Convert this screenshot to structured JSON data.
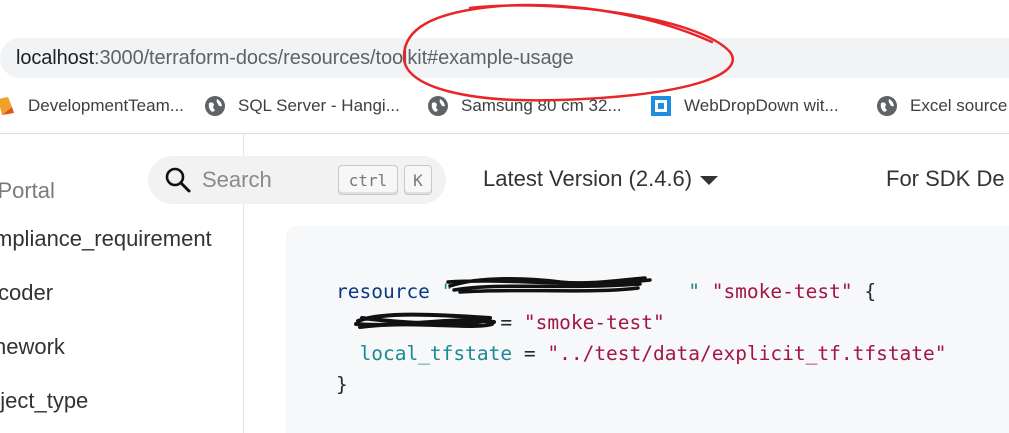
{
  "browser": {
    "url": {
      "host": "localhost",
      "path": ":3000/terraform-docs/resources/toolkit#example-usage"
    },
    "bookmarks": [
      {
        "label": "DevelopmentTeam..."
      },
      {
        "label": "SQL Server - Hangi..."
      },
      {
        "label": "Samsung 80 cm 32..."
      },
      {
        "label": "WebDropDown wit..."
      },
      {
        "label": "Excel source"
      }
    ]
  },
  "sidebar": {
    "portal_label": "r Portal",
    "items": [
      {
        "label": "mpliance_requirement"
      },
      {
        "label": "coder"
      },
      {
        "label": "nework"
      },
      {
        "label": "oject_type"
      }
    ]
  },
  "header": {
    "search_placeholder": "Search",
    "search_keys": [
      "ctrl",
      "K"
    ],
    "version_label": "Latest Version (2.4.6)",
    "sdk_label": "For SDK De"
  },
  "code": {
    "line1_keyword": "resource",
    "line1_type": "\"                    \"",
    "line1_name": "\"smoke-test\"",
    "line1_brace": "{",
    "line2_key": "",
    "line2_eq": "=",
    "line2_value": "\"smoke-test\"",
    "line3_key": "local_tfstate",
    "line3_eq": "=",
    "line3_value": "\"../test/data/explicit_tf.tfstate\"",
    "line4_brace": "}"
  },
  "colors": {
    "annotation": "#e8262a",
    "keyword": "#0b3a82",
    "string": "#a31545",
    "attribute": "#1b8a93"
  }
}
